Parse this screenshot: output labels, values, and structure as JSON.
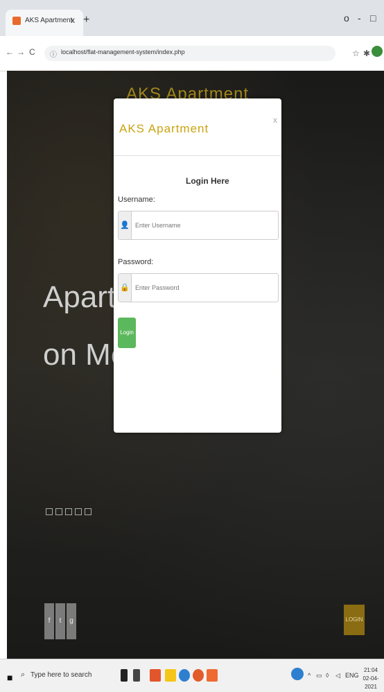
{
  "browser": {
    "tab_title": "AKS Apartment",
    "tab_close": "x",
    "new_tab": "+",
    "window_controls": [
      "o",
      "-",
      "□"
    ],
    "nav": [
      "←",
      "→",
      "C"
    ],
    "url": "localhost/flat-management-system/index.php",
    "lock_icon": "ⓘ",
    "star": "☆",
    "extensions": "✱"
  },
  "hero": {
    "brand": "AKS Apartment",
    "line1": "Apartmer",
    "line2": "on Melbou",
    "social": [
      "f",
      "t",
      "g"
    ],
    "login_label": "LOGIN"
  },
  "modal": {
    "title": "AKS Apartment",
    "close": "x",
    "heading": "Login Here",
    "username_label": "Username:",
    "username_placeholder": "Enter Username",
    "password_label": "Password:",
    "password_placeholder": "Enter Password",
    "submit": "Login",
    "colors": {
      "title": "#c9a30f",
      "submit": "#5cb85c"
    }
  },
  "taskbar": {
    "search_placeholder": "Type here to search",
    "tray_text": "ENG",
    "time": "21:04",
    "date": "02-04-2021"
  }
}
